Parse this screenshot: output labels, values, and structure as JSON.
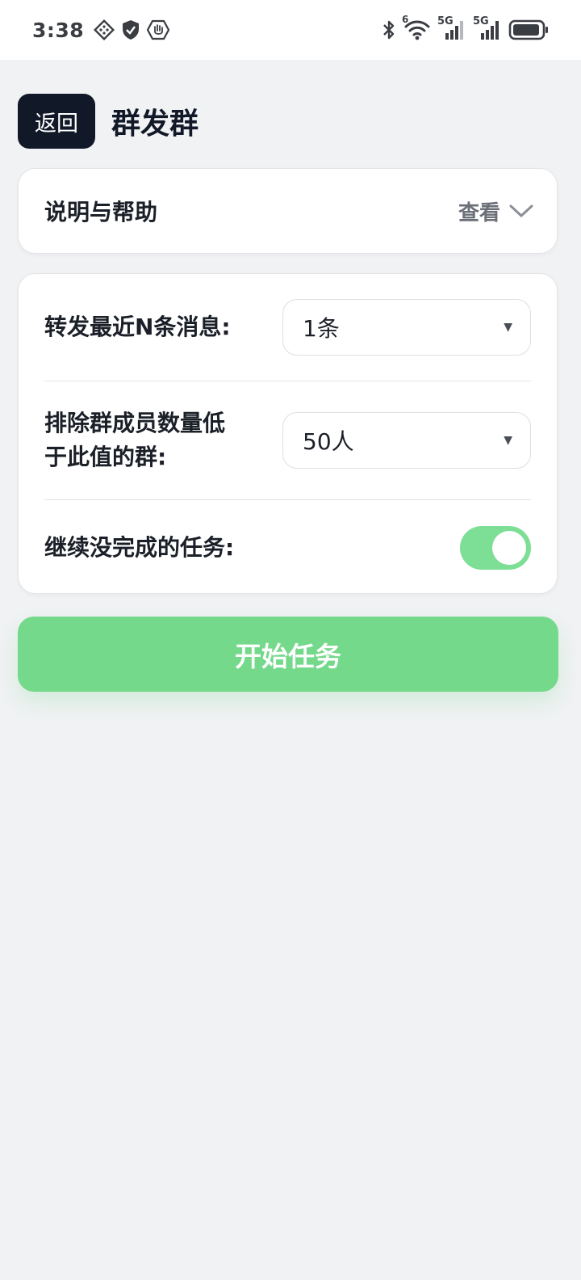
{
  "status_bar": {
    "time": "3:38",
    "left_icons": [
      "diamond-grid-icon",
      "shield-check-icon",
      "hand-stop-icon"
    ],
    "right_icons": [
      "bluetooth-icon",
      "wifi-icon",
      "signal-5g-icon",
      "signal-5g-icon",
      "battery-icon"
    ],
    "wifi_badge": "6",
    "sim1_label": "5G",
    "sim2_label": "5G"
  },
  "header": {
    "back_label": "返回",
    "title": "群发群"
  },
  "help": {
    "title": "说明与帮助",
    "view_label": "查看"
  },
  "settings": {
    "forward_label": "转发最近N条消息:",
    "forward_value": "1条",
    "exclude_label_line1": "排除群成员数量低",
    "exclude_label_line2": "于此值的群:",
    "exclude_value": "50人",
    "resume_label": "继续没完成的任务:",
    "resume_enabled": true
  },
  "actions": {
    "start_label": "开始任务"
  },
  "colors": {
    "accent_green": "#74d98a",
    "dark_button": "#111827",
    "background": "#f1f2f4"
  }
}
